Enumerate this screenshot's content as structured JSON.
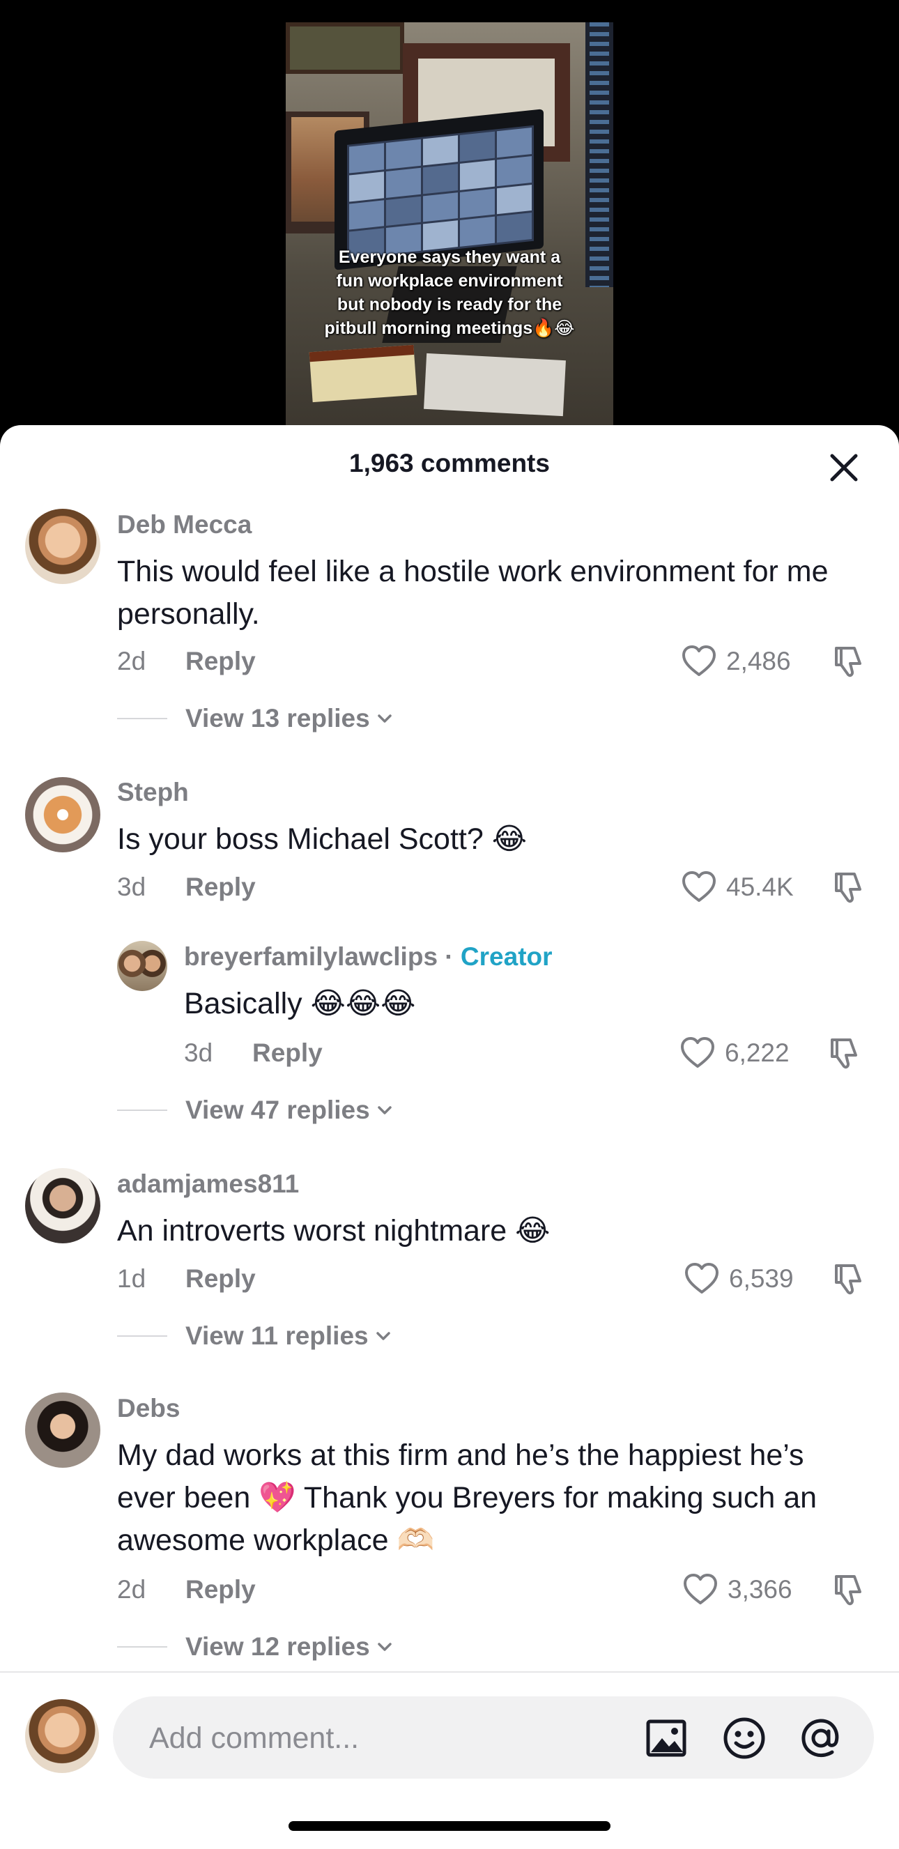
{
  "video": {
    "caption": "Everyone says they want a\nfun workplace environment\nbut nobody is ready for the\npitbull morning meetings🔥😂"
  },
  "sheet": {
    "title": "1,963 comments",
    "close_icon": "close-icon"
  },
  "comments": [
    {
      "username": "Deb Mecca",
      "text": "This would feel like a hostile work environment for me personally.",
      "time": "2d",
      "reply_label": "Reply",
      "likes": "2,486",
      "view_replies": "View 13 replies"
    },
    {
      "username": "Steph",
      "text": "Is your boss Michael Scott? 😂",
      "time": "3d",
      "reply_label": "Reply",
      "likes": "45.4K",
      "reply": {
        "username": "breyerfamilylawclips",
        "separator": " · ",
        "badge": "Creator",
        "text": "Basically 😂😂😂",
        "time": "3d",
        "reply_label": "Reply",
        "likes": "6,222"
      },
      "view_replies": "View 47 replies"
    },
    {
      "username": "adamjames811",
      "text": "An introverts worst nightmare 😂",
      "time": "1d",
      "reply_label": "Reply",
      "likes": "6,539",
      "view_replies": "View 11 replies"
    },
    {
      "username": "Debs",
      "text": "My dad works at this firm and he’s the happiest he’s ever been 💖 Thank you Breyers for making such an awesome workplace 🫶🏻",
      "time": "2d",
      "reply_label": "Reply",
      "likes": "3,366",
      "view_replies": "View 12 replies"
    }
  ],
  "input": {
    "placeholder": "Add comment...",
    "icons": [
      "image-icon",
      "emoji-icon",
      "mention-icon"
    ]
  },
  "colors": {
    "creator_badge": "#20a3c6",
    "secondary_text": "#7d7e83",
    "primary_text": "#161823"
  }
}
